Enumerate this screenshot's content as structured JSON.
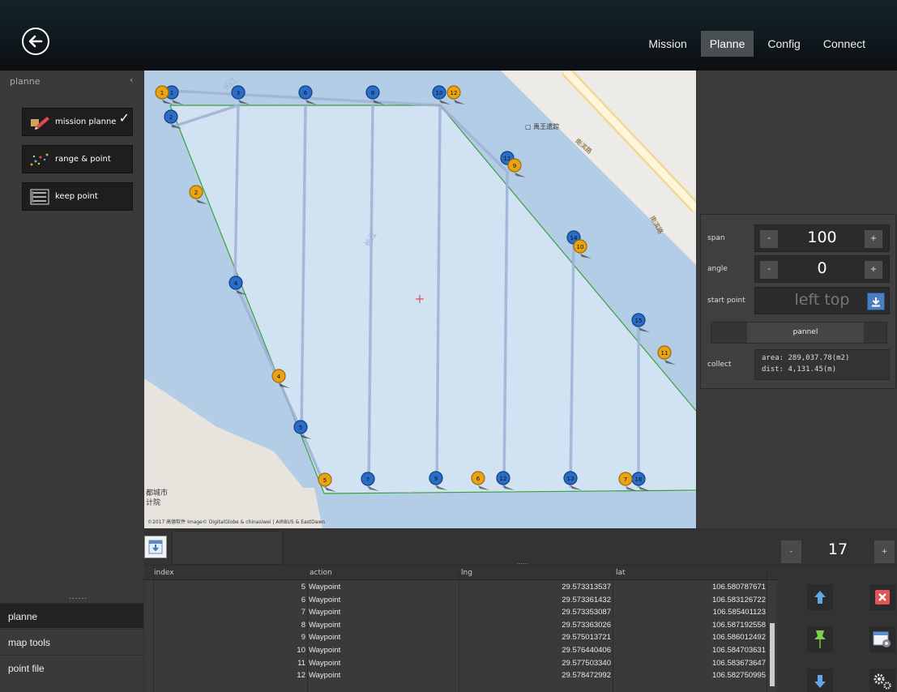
{
  "header": {
    "nav": [
      "Mission",
      "Planne",
      "Config",
      "Connect"
    ],
    "active_nav": "Planne"
  },
  "sidebar": {
    "title": "planne",
    "tools": [
      {
        "label": "mission planne",
        "checked": true
      },
      {
        "label": "range & point"
      },
      {
        "label": "keep point"
      }
    ],
    "dots": "......",
    "tabs": [
      "planne",
      "map tools",
      "point file"
    ],
    "active_tab": "planne"
  },
  "map": {
    "copyright": "©2017 高德软件 Image© DigitalGlobe & chinasiwei | AIRBUS & EastDawn",
    "poi": "禹王遗踪",
    "road_labels": [
      "南滨路",
      "南滨路"
    ],
    "river_labels": [
      "长江",
      "长江"
    ],
    "edge_labels": [
      "都城市",
      "计院"
    ],
    "blue_markers": [
      "1",
      "2",
      "3",
      "4",
      "5",
      "6",
      "7",
      "8",
      "9",
      "10",
      "11",
      "12",
      "13",
      "14",
      "15",
      "16"
    ],
    "yellow_markers": [
      "1",
      "2",
      "4",
      "5",
      "6",
      "7",
      "9",
      "10",
      "11",
      "12"
    ]
  },
  "params": {
    "span_label": "span",
    "span_value": "100",
    "angle_label": "angle",
    "angle_value": "0",
    "start_label": "start point",
    "start_value": "left top",
    "pannel_label": "pannel",
    "collect_label": "collect",
    "area": "area: 289,037.78(m2)",
    "dist": "dist: 4,131.45(m)",
    "minus": "-",
    "plus": "+"
  },
  "bottom": {
    "count": "17",
    "minus": "-",
    "plus": "+",
    "grip": "......"
  },
  "table": {
    "headers": [
      "index",
      "action",
      "lng",
      "lat"
    ],
    "rows": [
      [
        "5",
        "Waypoint",
        "29.573313537",
        "106.580787671"
      ],
      [
        "6",
        "Waypoint",
        "29.573361432",
        "106.583126722"
      ],
      [
        "7",
        "Waypoint",
        "29.573353087",
        "106.585401123"
      ],
      [
        "8",
        "Waypoint",
        "29.573363026",
        "106.587192558"
      ],
      [
        "9",
        "Waypoint",
        "29.575013721",
        "106.586012492"
      ],
      [
        "10",
        "Waypoint",
        "29.576440406",
        "106.584703631"
      ],
      [
        "11",
        "Waypoint",
        "29.577503340",
        "106.583673647"
      ],
      [
        "12",
        "Waypoint",
        "29.578472992",
        "106.582750995"
      ]
    ]
  },
  "colors": {
    "accent": "#4a7fbf",
    "polygon": "#3aa13a",
    "marker_blue": "#2a6cc8",
    "marker_yellow": "#e8a415"
  }
}
